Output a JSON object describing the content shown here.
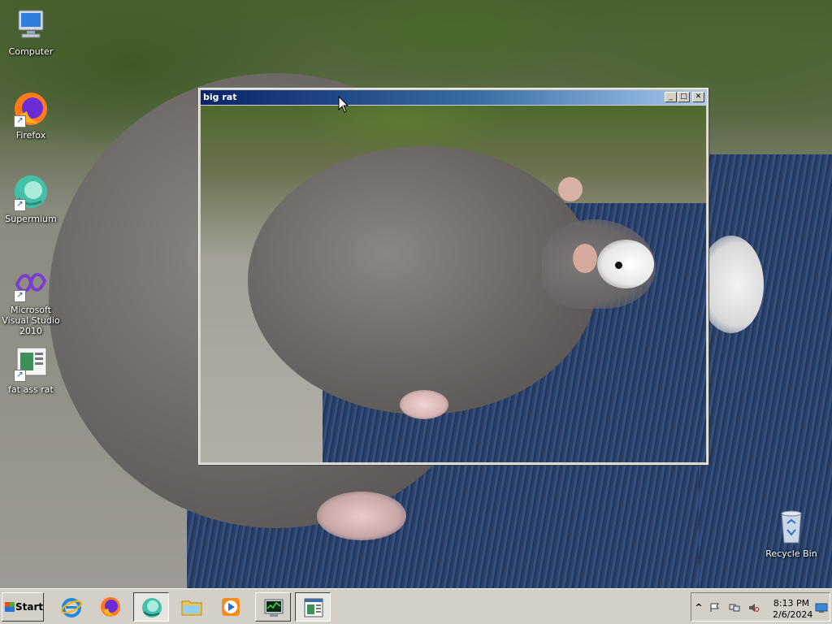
{
  "desktop": {
    "icons": [
      {
        "label": "Computer",
        "icon": "computer-icon",
        "shortcut": false
      },
      {
        "label": "Firefox",
        "icon": "firefox-icon",
        "shortcut": true
      },
      {
        "label": "Supermium",
        "icon": "supermium-icon",
        "shortcut": true
      },
      {
        "label": "Microsoft Visual Studio 2010",
        "icon": "visual-studio-icon",
        "shortcut": true
      },
      {
        "label": "fat ass rat",
        "icon": "image-viewer-icon",
        "shortcut": true
      },
      {
        "label": "Recycle Bin",
        "icon": "recycle-bin-icon",
        "shortcut": false
      }
    ]
  },
  "window": {
    "title": "big rat",
    "minimize_glyph": "_",
    "maximize_glyph": "□",
    "close_glyph": "✕"
  },
  "taskbar": {
    "start_label": "Start",
    "pinned": [
      {
        "icon": "internet-explorer-icon"
      },
      {
        "icon": "firefox-icon"
      },
      {
        "icon": "supermium-icon",
        "state": "active"
      },
      {
        "icon": "file-explorer-icon"
      },
      {
        "icon": "media-player-icon"
      },
      {
        "icon": "task-manager-icon",
        "state": "raised"
      },
      {
        "icon": "image-viewer-icon",
        "state": "active"
      }
    ],
    "tray": {
      "expand_glyph": "^",
      "time": "8:13 PM",
      "date": "2/6/2024",
      "icons": [
        "action-center-flag-icon",
        "network-icon",
        "volume-muted-icon",
        "show-desktop-icon"
      ]
    }
  },
  "colors": {
    "title_active_start": "#0a246a",
    "title_active_end": "#a6caf0",
    "taskbar": "#d4d0c8"
  }
}
